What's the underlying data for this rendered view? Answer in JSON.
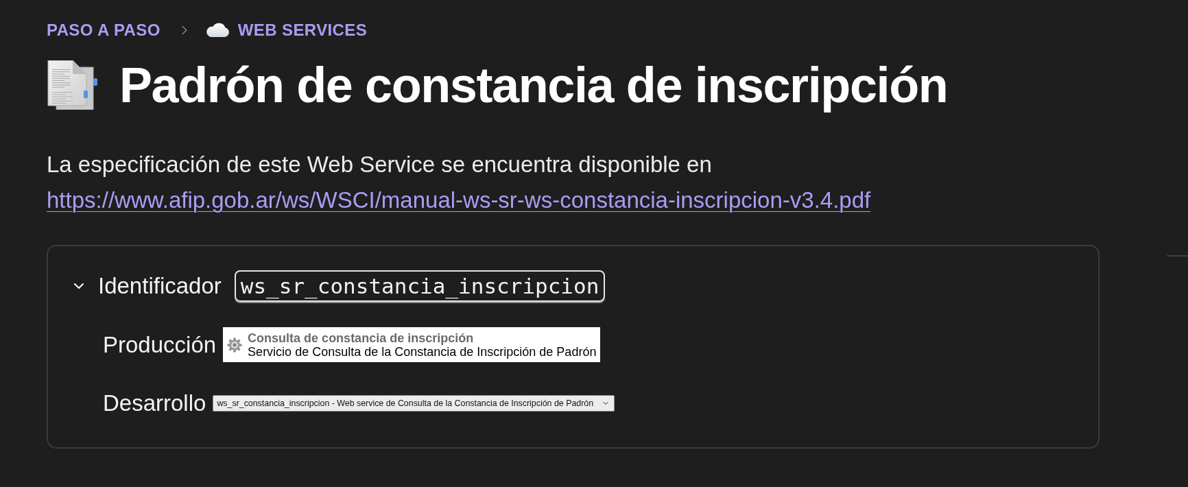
{
  "breadcrumb": [
    {
      "label": "PASO A PASO"
    },
    {
      "label": "WEB SERVICES"
    }
  ],
  "title": "Padrón de constancia de inscripción",
  "intro": {
    "text": "La especificación de este Web Service se encuentra disponible en",
    "link": "https://www.afip.gob.ar/ws/WSCI/manual-ws-sr-ws-constancia-inscripcion-v3.4.pdf"
  },
  "details": {
    "expanded": true,
    "label": "Identificador",
    "identifier": "ws_sr_constancia_inscripcion",
    "environments": [
      {
        "kind": "service-card",
        "label": "Producción",
        "title": "Consulta de constancia de inscripción",
        "description": "Servicio de Consulta de la Constancia de Inscripción de Padrón"
      },
      {
        "kind": "dropdown",
        "label": "Desarrollo",
        "value": "ws_sr_constancia_inscripcion - Web service de Consulta de la Constancia de Inscripción de Padrón"
      }
    ]
  }
}
